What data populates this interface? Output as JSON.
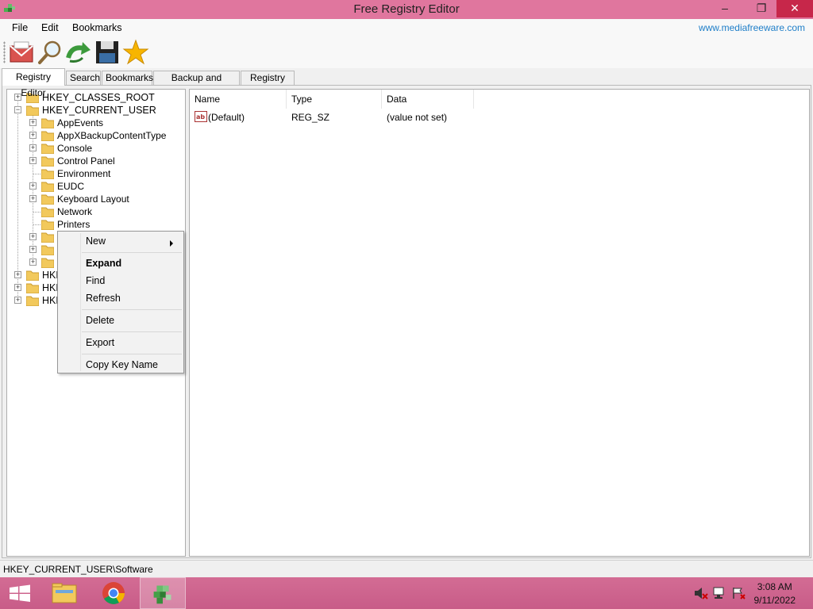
{
  "window": {
    "title": "Free Registry Editor",
    "controls": {
      "minimize": "–",
      "maximize": "❐",
      "close": "✕"
    }
  },
  "menubar": {
    "items": [
      "File",
      "Edit",
      "Bookmarks"
    ],
    "site_link": "www.mediafreeware.com"
  },
  "toolbar": {
    "buttons": [
      "mail-icon",
      "search-icon",
      "refresh-icon",
      "save-icon",
      "star-icon"
    ]
  },
  "tabs": [
    {
      "label": "Registry Editor",
      "active": true
    },
    {
      "label": "Search",
      "active": false
    },
    {
      "label": "Bookmarks",
      "active": false
    },
    {
      "label": "Backup and Restore",
      "active": false
    },
    {
      "label": "Registry Diff",
      "active": false
    }
  ],
  "tree": {
    "roots_top": [
      "HKEY_CLASSES_ROOT",
      "HKEY_CURRENT_USER"
    ],
    "children": [
      "AppEvents",
      "AppXBackupContentType",
      "Console",
      "Control Panel",
      "Environment",
      "EUDC",
      "Keyboard Layout",
      "Network",
      "Printers"
    ],
    "roots_bottom_partial": [
      "HKE",
      "HKE",
      "HKE"
    ]
  },
  "list": {
    "columns": [
      "Name",
      "Type",
      "Data"
    ],
    "rows": [
      {
        "name": "(Default)",
        "type": "REG_SZ",
        "data": "(value not set)"
      }
    ]
  },
  "context_menu": {
    "items": [
      "New",
      "Expand",
      "Find",
      "Refresh",
      "Delete",
      "Export",
      "Copy Key Name"
    ]
  },
  "status": {
    "path": "HKEY_CURRENT_USER\\Software"
  },
  "taskbar": {
    "time": "3:08 AM",
    "date": "9/11/2022"
  },
  "colors": {
    "titlebar": "#e0769e",
    "close_button": "#c7274a",
    "taskbar": "#d36c94",
    "link": "#1e7ec8",
    "folder": "#f2c95c"
  }
}
